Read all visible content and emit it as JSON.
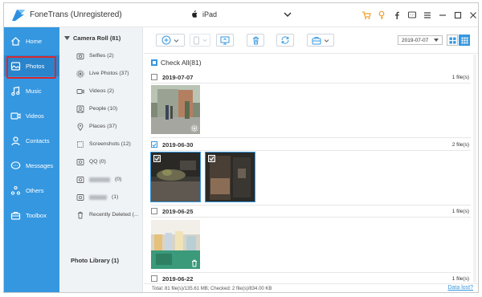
{
  "app": {
    "title": "FoneTrans (Unregistered)"
  },
  "device": {
    "name": "iPad"
  },
  "sidebar": {
    "items": [
      {
        "label": "Home",
        "icon": "home-icon"
      },
      {
        "label": "Photos",
        "icon": "photos-icon",
        "active": true
      },
      {
        "label": "Music",
        "icon": "music-icon"
      },
      {
        "label": "Videos",
        "icon": "video-icon"
      },
      {
        "label": "Contacts",
        "icon": "contacts-icon"
      },
      {
        "label": "Messages",
        "icon": "messages-icon"
      },
      {
        "label": "Others",
        "icon": "others-icon"
      },
      {
        "label": "Toolbox",
        "icon": "toolbox-icon"
      }
    ]
  },
  "categories": {
    "header": "Camera Roll (81)",
    "items": [
      {
        "label": "Selfies (2)",
        "icon": "selfie-icon"
      },
      {
        "label": "Live Photos (37)",
        "icon": "live-photos-icon"
      },
      {
        "label": "Videos (2)",
        "icon": "video-icon"
      },
      {
        "label": "People (10)",
        "icon": "people-icon"
      },
      {
        "label": "Places (37)",
        "icon": "places-icon"
      },
      {
        "label": "Screenshots (12)",
        "icon": "screenshot-icon"
      },
      {
        "label": "QQ (0)",
        "icon": "album-icon"
      },
      {
        "label": "(0)",
        "icon": "album-icon",
        "blurred": true
      },
      {
        "label": "(1)",
        "icon": "album-icon",
        "blurred": true
      },
      {
        "label": "Recently Deleted (...",
        "icon": "trash-icon"
      }
    ],
    "library": "Photo Library (1)"
  },
  "toolbar": {
    "date": "2019-07-07"
  },
  "content": {
    "check_all": "Check All(81)",
    "groups": [
      {
        "date": "2019-07-07",
        "count": "1 file(s)",
        "checked": false
      },
      {
        "date": "2019-06-30",
        "count": "2 file(s)",
        "checked": true
      },
      {
        "date": "2019-06-25",
        "count": "1 file(s)",
        "checked": false
      },
      {
        "date": "2019-06-22",
        "count": "1 file(s)",
        "checked": false
      }
    ]
  },
  "status": {
    "text": "Total: 81 file(s)/135.61 MB; Checked: 2 file(s)/834.00 KB",
    "link": "Data lost?"
  },
  "colors": {
    "accent": "#3597e0",
    "sidebar": "#3597e0",
    "active_outline": "#d7282f",
    "cart": "#f0a030"
  }
}
